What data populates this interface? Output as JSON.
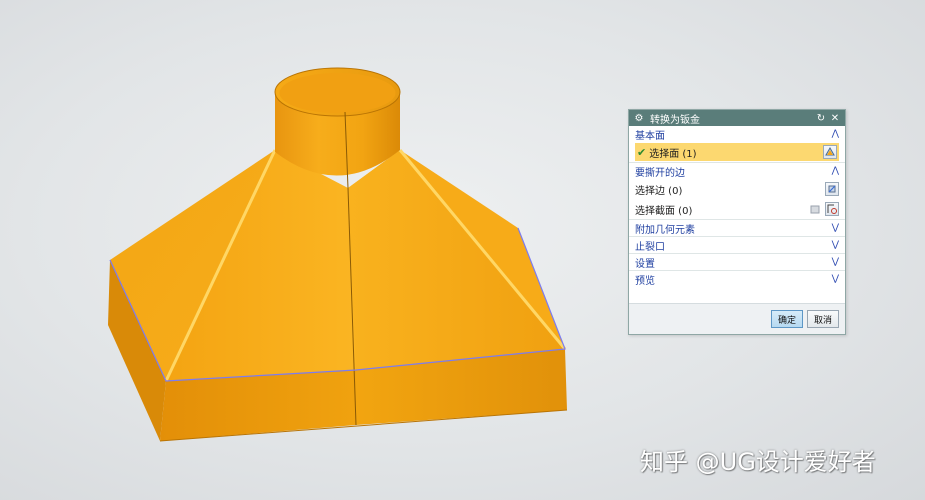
{
  "dialog": {
    "title": "转换为钣金",
    "reset_glyph": "↻",
    "close_glyph": "✕",
    "groups": [
      {
        "label": "基本面",
        "expanded": true,
        "rows": [
          {
            "label": "选择面 (1)",
            "selected": true,
            "icon": "face-select-icon"
          }
        ]
      },
      {
        "label": "要撕开的边",
        "expanded": true,
        "rows": [
          {
            "label": "选择边 (0)",
            "selected": false,
            "icon": "edge-select-icon"
          },
          {
            "label": "选择截面 (0)",
            "selected": false,
            "icon": "section-curve-icon"
          }
        ]
      },
      {
        "label": "附加几何元素",
        "expanded": false
      },
      {
        "label": "止裂口",
        "expanded": false
      },
      {
        "label": "设置",
        "expanded": false
      },
      {
        "label": "预览",
        "expanded": false
      }
    ],
    "ok_label": "确定",
    "cancel_label": "取消"
  },
  "watermark": "知乎 @UG设计爱好者",
  "colors": {
    "part_orange": "#f5a40e",
    "part_shadow": "#c97f07",
    "edge_highlight": "#7c7cf0",
    "dialog_title": "#5a7d7a",
    "selection_yellow": "#fcd870"
  }
}
